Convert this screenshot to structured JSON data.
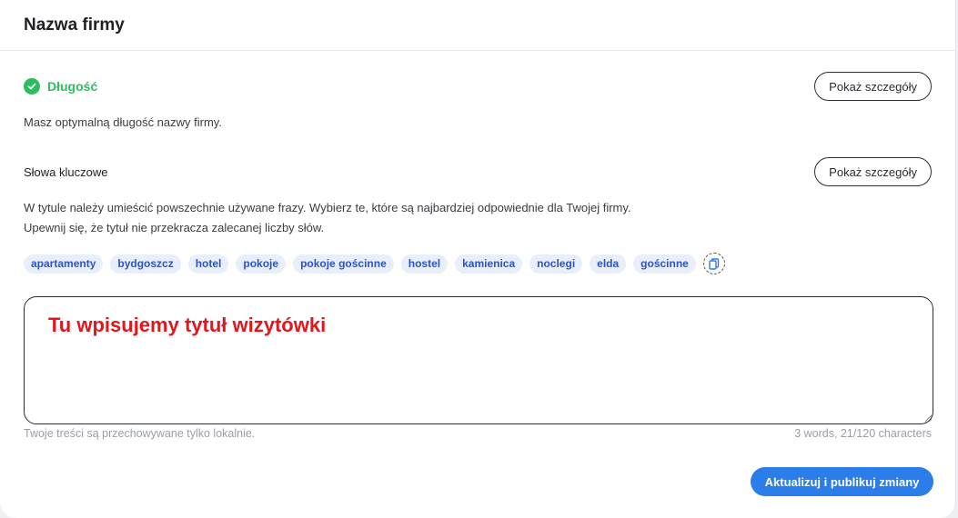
{
  "header": {
    "title": "Nazwa firmy"
  },
  "length": {
    "status_label": "Długość",
    "details_label": "Pokaż szczegóły",
    "message": "Masz optymalną długość nazwy firmy."
  },
  "keywords": {
    "title": "Słowa kluczowe",
    "details_label": "Pokaż szczegóły",
    "description_line1": "W tytule należy umieścić powszechnie używane frazy. Wybierz te, które są najbardziej odpowiednie dla Twojej firmy.",
    "description_line2": "Upewnij się, że tytuł nie przekracza zalecanej liczby słów.",
    "tags": [
      "apartamenty",
      "bydgoszcz",
      "hotel",
      "pokoje",
      "pokoje gościnne",
      "hostel",
      "kamienica",
      "noclegi",
      "elda",
      "gościnne"
    ],
    "copy_icon": "copy-icon"
  },
  "editor": {
    "value": "Tu wpisujemy tytuł wizytówki",
    "storage_note": "Twoje treści są przechowywane tylko lokalnie.",
    "counter": "3 words, 21/120 characters"
  },
  "footer": {
    "publish_label": "Aktualizuj i publikuj zmiany"
  },
  "colors": {
    "success": "#2bbd5f",
    "tag_bg": "#e9eefb",
    "tag_text": "#2b54c8",
    "primary": "#2b7de9",
    "annotation_text": "#e3161c"
  }
}
